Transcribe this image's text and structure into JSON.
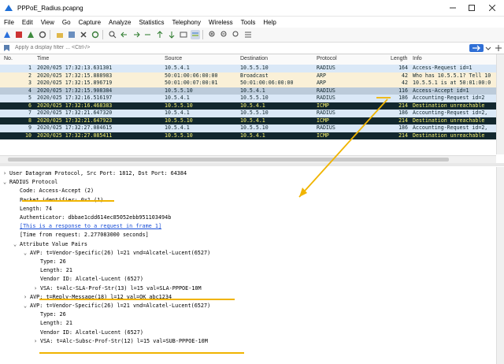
{
  "window": {
    "title": "PPPoE_Radius.pcapng"
  },
  "menu": [
    "File",
    "Edit",
    "View",
    "Go",
    "Capture",
    "Analyze",
    "Statistics",
    "Telephony",
    "Wireless",
    "Tools",
    "Help"
  ],
  "filter": {
    "placeholder": "Apply a display filter ... <Ctrl-/>"
  },
  "columns": [
    "No.",
    "Time",
    "Source",
    "Destination",
    "Protocol",
    "Length",
    "Info"
  ],
  "packets": [
    {
      "no": "1",
      "time": "2020/025 17:32:13.631301",
      "src": "10.5.4.1",
      "dst": "10.5.5.10",
      "proto": "RADIUS",
      "len": "164",
      "info": "Access-Request id=1",
      "bg": "#dae8f7",
      "fg": "#12272e"
    },
    {
      "no": "2",
      "time": "2020/025 17:32:15.888983",
      "src": "50:01:00:06:00:00",
      "dst": "Broadcast",
      "proto": "ARP",
      "len": "42",
      "info": "Who has 10.5.5.1? Tell 10",
      "bg": "#faf0d7",
      "fg": "#12272e"
    },
    {
      "no": "3",
      "time": "2020/025 17:32:15.896719",
      "src": "50:01:00:07:00:01",
      "dst": "50:01:00:06:00:00",
      "proto": "ARP",
      "len": "42",
      "info": "10.5.5.1 is at 50:01:00:0",
      "bg": "#faf0d7",
      "fg": "#12272e"
    },
    {
      "no": "4",
      "time": "2020/025 17:32:15.908384",
      "src": "10.5.5.10",
      "dst": "10.5.4.1",
      "proto": "RADIUS",
      "len": "116",
      "info": "Access-Accept id=1",
      "bg": "#bccbda",
      "fg": "#12272e"
    },
    {
      "no": "5",
      "time": "2020/025 17:32:16.516197",
      "src": "10.5.4.1",
      "dst": "10.5.5.10",
      "proto": "RADIUS",
      "len": "186",
      "info": "Accounting-Request id=2",
      "bg": "#dae8f7",
      "fg": "#12272e"
    },
    {
      "no": "6",
      "time": "2020/025 17:32:16.468383",
      "src": "10.5.5.10",
      "dst": "10.5.4.1",
      "proto": "ICMP",
      "len": "214",
      "info": "Destination unreachable",
      "bg": "#12272e",
      "fg": "#f7f270"
    },
    {
      "no": "7",
      "time": "2020/025 17:32:21.647320",
      "src": "10.5.4.1",
      "dst": "10.5.5.10",
      "proto": "RADIUS",
      "len": "186",
      "info": "Accounting-Request id=2,",
      "bg": "#dae8f7",
      "fg": "#12272e"
    },
    {
      "no": "8",
      "time": "2020/025 17:32:21.647923",
      "src": "10.5.5.10",
      "dst": "10.5.4.1",
      "proto": "ICMP",
      "len": "214",
      "info": "Destination unreachable",
      "bg": "#12272e",
      "fg": "#f7f270"
    },
    {
      "no": "9",
      "time": "2020/025 17:32:27.084615",
      "src": "10.5.4.1",
      "dst": "10.5.5.10",
      "proto": "RADIUS",
      "len": "186",
      "info": "Accounting-Request id=2,",
      "bg": "#dae8f7",
      "fg": "#12272e"
    },
    {
      "no": "10",
      "time": "2020/025 17:32:27.085411",
      "src": "10.5.5.10",
      "dst": "10.5.4.1",
      "proto": "ICMP",
      "len": "214",
      "info": "Destination unreachable",
      "bg": "#12272e",
      "fg": "#f7f270"
    }
  ],
  "details": [
    {
      "indent": 0,
      "tri": "›",
      "text": "User Datagram Protocol, Src Port: 1812, Dst Port: 64384",
      "style": ""
    },
    {
      "indent": 0,
      "tri": "⌄",
      "text": "RADIUS Protocol",
      "style": ""
    },
    {
      "indent": 1,
      "tri": "",
      "text": "Code: Access-Accept (2)",
      "style": ""
    },
    {
      "indent": 1,
      "tri": "",
      "text": "Packet identifier: 0x1 (1)",
      "style": ""
    },
    {
      "indent": 1,
      "tri": "",
      "text": "Length: 74",
      "style": ""
    },
    {
      "indent": 1,
      "tri": "",
      "text": "Authenticator: dbbae1cdd614ec85052ebb951103494b",
      "style": ""
    },
    {
      "indent": 1,
      "tri": "",
      "text": "[This is a response to a request in frame 1]",
      "style": "link"
    },
    {
      "indent": 1,
      "tri": "",
      "text": "[Time from request: 2.277083000 seconds]",
      "style": ""
    },
    {
      "indent": 1,
      "tri": "⌄",
      "text": "Attribute Value Pairs",
      "style": ""
    },
    {
      "indent": 2,
      "tri": "⌄",
      "text": "AVP: t=Vendor-Specific(26) l=21 vnd=Alcatel-Lucent(6527)",
      "style": ""
    },
    {
      "indent": 3,
      "tri": "",
      "text": "Type: 26",
      "style": ""
    },
    {
      "indent": 3,
      "tri": "",
      "text": "Length: 21",
      "style": ""
    },
    {
      "indent": 3,
      "tri": "",
      "text": "Vendor ID: Alcatel-Lucent (6527)",
      "style": ""
    },
    {
      "indent": 3,
      "tri": "›",
      "text": "VSA: t=Alc-SLA-Prof-Str(13) l=15 val=SLA-PPPOE-10M",
      "style": ""
    },
    {
      "indent": 2,
      "tri": "›",
      "text": "AVP: t=Reply-Message(18) l=12 val=OK_abc1234",
      "style": ""
    },
    {
      "indent": 2,
      "tri": "⌄",
      "text": "AVP: t=Vendor-Specific(26) l=21 vnd=Alcatel-Lucent(6527)",
      "style": ""
    },
    {
      "indent": 3,
      "tri": "",
      "text": "Type: 26",
      "style": ""
    },
    {
      "indent": 3,
      "tri": "",
      "text": "Length: 21",
      "style": ""
    },
    {
      "indent": 3,
      "tri": "",
      "text": "Vendor ID: Alcatel-Lucent (6527)",
      "style": ""
    },
    {
      "indent": 3,
      "tri": "›",
      "text": "VSA: t=Alc-Subsc-Prof-Str(12) l=15 val=SUB-PPPOE-10M",
      "style": ""
    }
  ],
  "colors": {
    "accent": "#f0b400",
    "link": "#1a4fd6",
    "selected_row": "#bccbda"
  }
}
